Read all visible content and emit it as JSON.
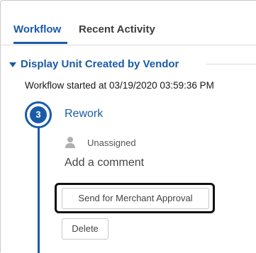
{
  "tabs": [
    {
      "label": "Workflow",
      "active": true
    },
    {
      "label": "Recent Activity",
      "active": false
    }
  ],
  "section": {
    "title": "Display Unit Created by Vendor",
    "expanded": true,
    "started_text": "Workflow started at 03/19/2020 03:59:36 PM"
  },
  "step": {
    "number": "3",
    "title": "Rework",
    "assignee": "Unassigned",
    "assignee_icon": "user-icon",
    "comment_placeholder": "Add a comment"
  },
  "actions": {
    "send_label": "Send for Merchant Approval",
    "delete_label": "Delete"
  },
  "colors": {
    "accent": "#1a5ba8",
    "text": "#181818",
    "border": "#c9c9c9"
  }
}
